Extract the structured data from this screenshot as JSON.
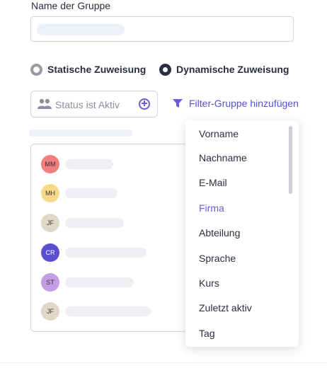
{
  "form": {
    "group_name_label": "Name der Gruppe",
    "assignment": {
      "static_label": "Statische Zuweisung",
      "dynamic_label": "Dynamische Zuweisung",
      "selected": "dynamic"
    },
    "filter_chip": {
      "icon": "group-icon",
      "text": "Status ist Aktiv",
      "add_icon": "plus-circle-icon"
    },
    "add_filter_group_label": "Filter-Gruppe hinzufügen"
  },
  "members": [
    {
      "initials": "MM",
      "bg": "#f08080",
      "fg": "#3a2b2b"
    },
    {
      "initials": "MH",
      "bg": "#f7d98a",
      "fg": "#3a342b"
    },
    {
      "initials": "JF",
      "bg": "#e0d8c6",
      "fg": "#3a3a3a"
    },
    {
      "initials": "CR",
      "bg": "#5b4fd1",
      "fg": "#ffffff"
    },
    {
      "initials": "ST",
      "bg": "#c49ee3",
      "fg": "#3a2b45"
    },
    {
      "initials": "JF",
      "bg": "#e0d8c6",
      "fg": "#3a3a3a"
    }
  ],
  "dropdown": {
    "items": [
      "Vorname",
      "Nachname",
      "E-Mail",
      "Firma",
      "Abteilung",
      "Sprache",
      "Kurs",
      "Zuletzt aktiv",
      "Tag"
    ],
    "highlighted": "Firma"
  },
  "colors": {
    "accent": "#6b5bd6",
    "text": "#2b2d42",
    "muted": "#8b8fa3",
    "border": "#d3d3df"
  }
}
